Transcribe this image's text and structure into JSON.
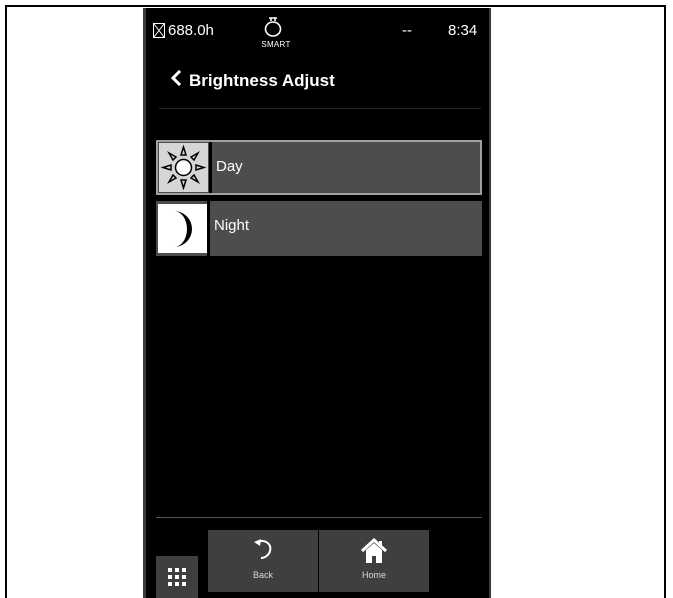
{
  "status": {
    "hours": "688.0h",
    "smart_label": "SMART",
    "signal": "--",
    "time": "8:34"
  },
  "header": {
    "title": "Brightness Adjust"
  },
  "options": [
    {
      "label": "Day",
      "icon": "sun-icon",
      "selected": true
    },
    {
      "label": "Night",
      "icon": "moon-icon",
      "selected": false
    }
  ],
  "nav": {
    "back_label": "Back",
    "home_label": "Home",
    "menu_icon": "grid-menu-icon"
  }
}
